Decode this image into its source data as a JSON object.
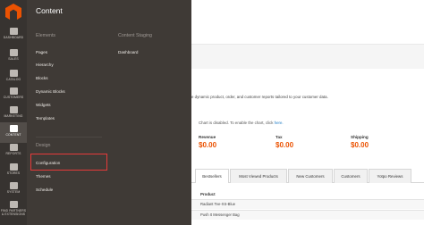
{
  "sidebar": {
    "items": [
      {
        "label": "DASHBOARD",
        "icon": "dashboard-icon"
      },
      {
        "label": "SALES",
        "icon": "dollar-icon"
      },
      {
        "label": "CATALOG",
        "icon": "cube-icon"
      },
      {
        "label": "CUSTOMERS",
        "icon": "person-icon"
      },
      {
        "label": "MARKETING",
        "icon": "megaphone-icon"
      },
      {
        "label": "CONTENT",
        "icon": "layout-icon"
      },
      {
        "label": "REPORTS",
        "icon": "bar-chart-icon"
      },
      {
        "label": "STORES",
        "icon": "store-icon"
      },
      {
        "label": "SYSTEM",
        "icon": "gear-icon"
      },
      {
        "label": "FIND PARTNERS & EXTENSIONS",
        "icon": "puzzle-icon"
      }
    ],
    "active": "CONTENT"
  },
  "flyout": {
    "title": "Content",
    "close": "×",
    "elements_heading": "Elements",
    "elements": [
      "Pages",
      "Hierarchy",
      "Blocks",
      "Dynamic Blocks",
      "Widgets",
      "Templates"
    ],
    "staging_heading": "Content Staging",
    "staging": [
      "Dashboard"
    ],
    "design_heading": "Design",
    "design": [
      "Configuration",
      "Themes",
      "Schedule"
    ]
  },
  "main": {
    "intro_text": "e dynamic product, order, and customer reports tailored to your customer data.",
    "chart_note": "Chart is disabled. To enable the chart, click",
    "chart_link": "here.",
    "stats": [
      {
        "label": "Revenue",
        "value": "$0.00"
      },
      {
        "label": "Tax",
        "value": "$0.00"
      },
      {
        "label": "Shipping",
        "value": "$0.00"
      }
    ],
    "tabs": [
      "Bestsellers",
      "Most Viewed Products",
      "New Customers",
      "Customers",
      "Yotpo Reviews"
    ],
    "product_header": "Product",
    "products": [
      "Radiant Tee-XS-Blue",
      "Push It Messenger Bag"
    ]
  },
  "colors": {
    "accent": "#eb5202",
    "rail": "#373330",
    "flyout": "#3f3a36",
    "highlight": "#e63a3a"
  }
}
